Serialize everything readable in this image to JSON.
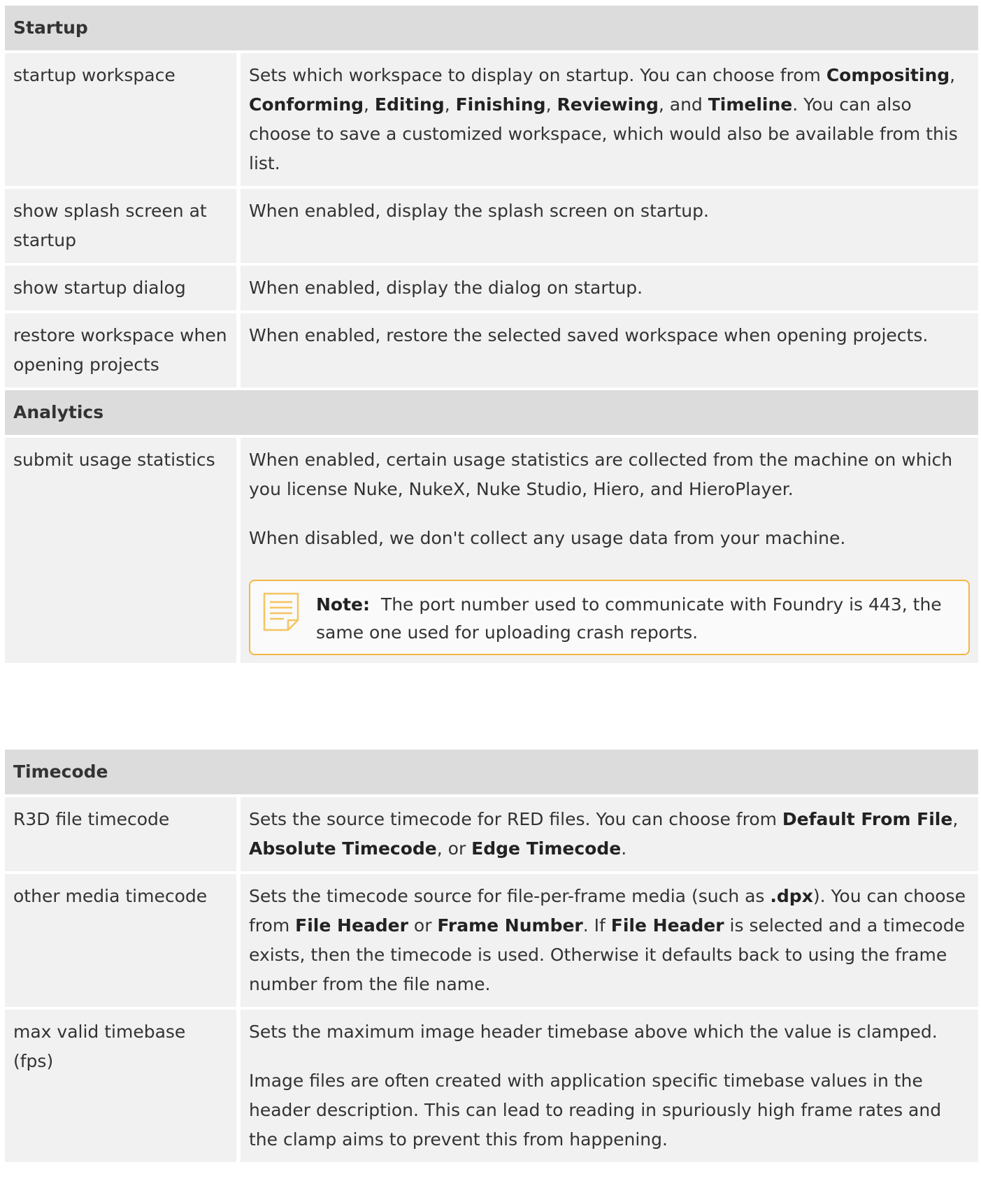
{
  "startup": {
    "header": "Startup",
    "rows": [
      {
        "label": "startup workspace",
        "desc_parts": [
          {
            "t": "Sets which workspace to display on startup. You can choose from "
          },
          {
            "t": "Compositing",
            "b": true
          },
          {
            "t": ", "
          },
          {
            "t": "Conforming",
            "b": true
          },
          {
            "t": ", "
          },
          {
            "t": "Editing",
            "b": true
          },
          {
            "t": ", "
          },
          {
            "t": "Finishing",
            "b": true
          },
          {
            "t": ", "
          },
          {
            "t": "Reviewing",
            "b": true
          },
          {
            "t": ", and "
          },
          {
            "t": "Timeline",
            "b": true
          },
          {
            "t": ". You can also choose to save a customized workspace, which would also be available from this list."
          }
        ]
      },
      {
        "label": "show splash screen at startup",
        "desc": "When enabled, display the splash screen on startup."
      },
      {
        "label": "show startup dialog",
        "desc": "When enabled, display the dialog on startup."
      },
      {
        "label": "restore workspace when opening projects",
        "desc": "When enabled, restore the selected saved workspace when opening projects."
      }
    ]
  },
  "analytics": {
    "header": "Analytics",
    "row": {
      "label": "submit usage statistics",
      "p1": "When enabled, certain usage statistics are collected from the machine on which you license Nuke, NukeX, Nuke Studio, Hiero, and HieroPlayer.",
      "p2": "When disabled, we don't collect any usage data from your machine.",
      "note_label": "Note:",
      "note_text": "The port number used to communicate with Foundry is 443, the same one used for uploading crash reports.",
      "note_icon": "note-icon",
      "note_color": "#f1b845"
    }
  },
  "timecode": {
    "header": "Timecode",
    "rows": [
      {
        "label": "R3D file timecode",
        "desc_parts": [
          {
            "t": "Sets the source timecode for RED files. You can choose from "
          },
          {
            "t": "Default From File",
            "b": true
          },
          {
            "t": ", "
          },
          {
            "t": "Absolute Timecode",
            "b": true
          },
          {
            "t": ", or "
          },
          {
            "t": "Edge Timecode",
            "b": true
          },
          {
            "t": "."
          }
        ]
      },
      {
        "label": "other media timecode",
        "desc_parts": [
          {
            "t": "Sets the timecode source for file-per-frame media (such as "
          },
          {
            "t": ".dpx",
            "b": true
          },
          {
            "t": "). You can choose from "
          },
          {
            "t": "File Header",
            "b": true
          },
          {
            "t": " or "
          },
          {
            "t": "Frame Number",
            "b": true
          },
          {
            "t": ". If "
          },
          {
            "t": "File Header",
            "b": true
          },
          {
            "t": " is selected and a timecode exists, then the timecode is used. Otherwise it defaults back to using the frame number from the file name."
          }
        ]
      },
      {
        "label": "max valid timebase (fps)",
        "p1": "Sets the maximum image header timebase above which the value is clamped.",
        "p2": "Image files are often created with application specific timebase values in the header description. This can lead to reading in spuriously high frame rates and the clamp aims to prevent this from happening."
      }
    ]
  }
}
